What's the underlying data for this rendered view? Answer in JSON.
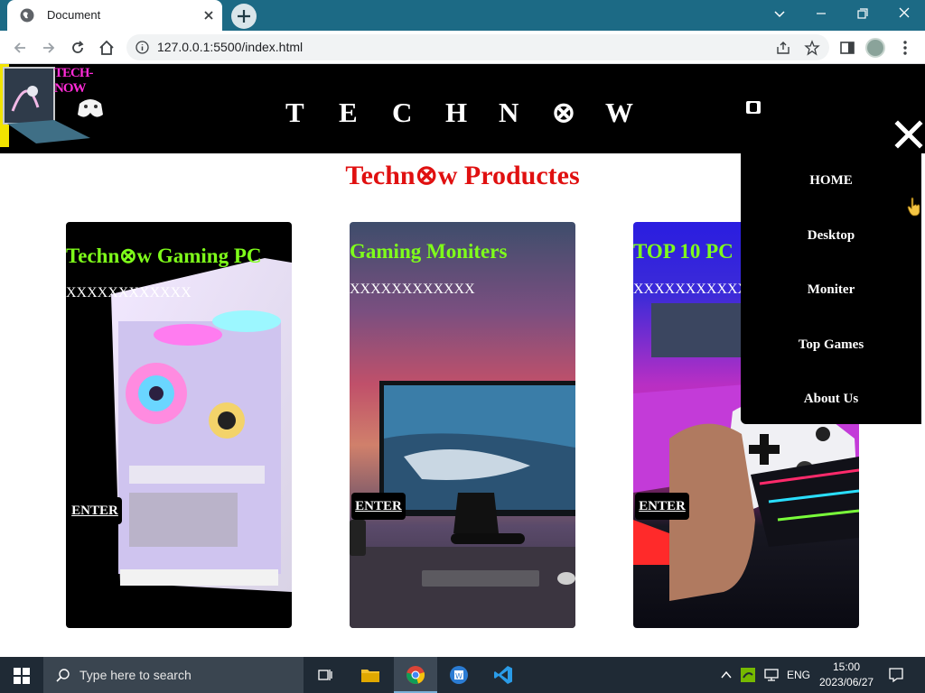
{
  "browser": {
    "tab_title": "Document",
    "url": "127.0.0.1:5500/index.html"
  },
  "site": {
    "logo_text": "TECH-NOW",
    "title_letters": [
      "T",
      "E",
      "C",
      "H",
      "N",
      "⊗",
      "W"
    ],
    "heading": "Techn⊗w Productes",
    "menu": [
      "HOME",
      "Desktop",
      "Moniter",
      "Top Games",
      "About Us"
    ],
    "cards": [
      {
        "title": "Techn⊗w Gaming PC",
        "subtitle": "XXXXXXXXXXXX",
        "button": "ENTER"
      },
      {
        "title": "Gaming Moniters",
        "subtitle": "XXXXXXXXXXXX",
        "button": "ENTER"
      },
      {
        "title": "TOP 10 PC",
        "subtitle": "XXXXXXXXXXX",
        "button": "ENTER"
      }
    ]
  },
  "taskbar": {
    "search_placeholder": "Type here to search",
    "language": "ENG",
    "time": "15:00",
    "date": "2023/06/27"
  },
  "colors": {
    "tabbar": "#1c6a85",
    "heading_red": "#e01010",
    "card_title_green": "#7fff1a"
  }
}
